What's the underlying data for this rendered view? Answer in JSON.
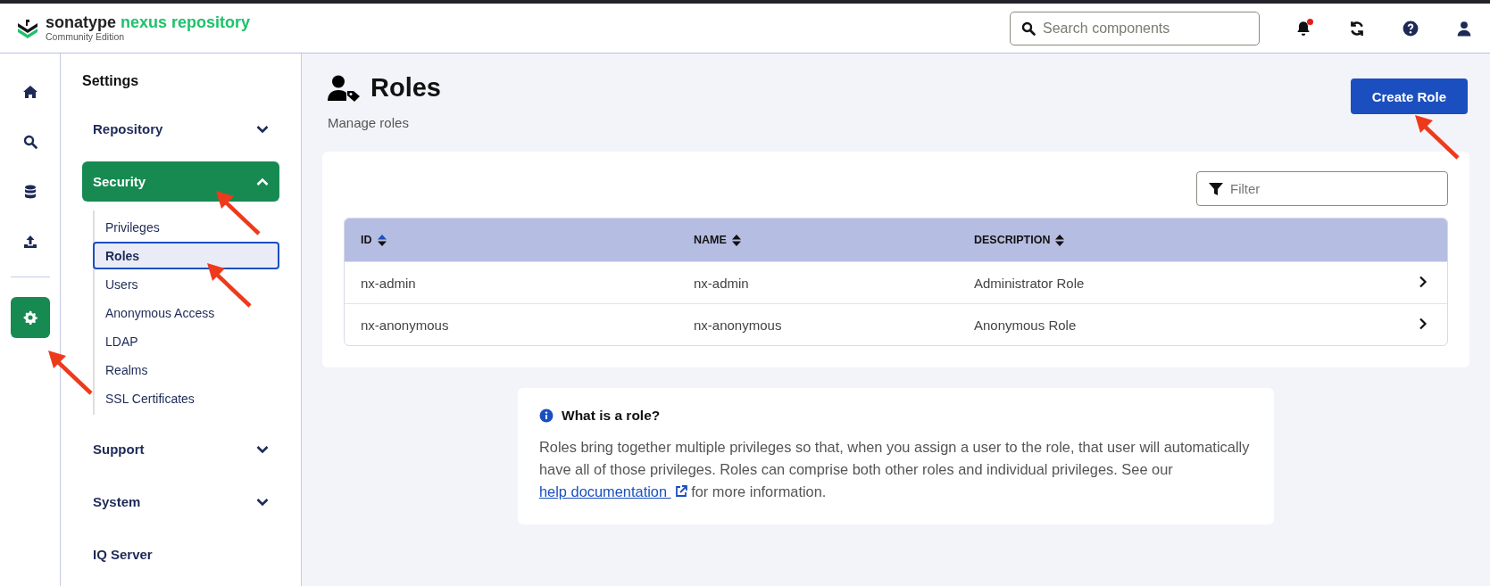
{
  "header": {
    "logo": {
      "brand": "sonatype",
      "product": "nexus repository",
      "edition": "Community Edition"
    },
    "search": {
      "placeholder": "Search components"
    },
    "notifications": {
      "unread": true
    }
  },
  "rail": [
    {
      "kind": "home",
      "selected": false,
      "annotated": false
    },
    {
      "kind": "search",
      "selected": false,
      "annotated": false
    },
    {
      "kind": "database",
      "selected": false,
      "annotated": false
    },
    {
      "kind": "upload",
      "selected": false,
      "annotated": false
    },
    {
      "kind": "settings",
      "selected": true,
      "annotated": true
    }
  ],
  "nav": {
    "title": "Settings",
    "sections": [
      {
        "label": "Repository",
        "expanded": false,
        "selected": false,
        "annotated": false
      },
      {
        "label": "Security",
        "expanded": true,
        "selected": true,
        "annotated": true,
        "children": [
          {
            "label": "Privileges",
            "selected": false,
            "annotated": false
          },
          {
            "label": "Roles",
            "selected": true,
            "annotated": true
          },
          {
            "label": "Users",
            "selected": false,
            "annotated": false
          },
          {
            "label": "Anonymous Access",
            "selected": false,
            "annotated": false
          },
          {
            "label": "LDAP",
            "selected": false,
            "annotated": false
          },
          {
            "label": "Realms",
            "selected": false,
            "annotated": false
          },
          {
            "label": "SSL Certificates",
            "selected": false,
            "annotated": false
          }
        ]
      },
      {
        "label": "Support",
        "expanded": false,
        "selected": false,
        "annotated": false
      },
      {
        "label": "System",
        "expanded": false,
        "selected": false,
        "annotated": false
      },
      {
        "label": "IQ Server",
        "selected": false,
        "annotated": false
      }
    ]
  },
  "page": {
    "title": "Roles",
    "subtitle": "Manage roles",
    "create_button": {
      "label": "Create Role",
      "annotated": true
    },
    "filter": {
      "placeholder": "Filter"
    },
    "table": {
      "columns": [
        {
          "label": "ID",
          "sorted": true
        },
        {
          "label": "NAME",
          "sorted": false
        },
        {
          "label": "DESCRIPTION",
          "sorted": false
        }
      ],
      "rows": [
        [
          "nx-admin",
          "nx-admin",
          "Administrator Role"
        ],
        [
          "nx-anonymous",
          "nx-anonymous",
          "Anonymous Role"
        ]
      ]
    },
    "info": {
      "title": "What is a role?",
      "text_before": "Roles bring together multiple privileges so that, when you assign a user to the role, that user will automatically have all of those privileges. Roles can comprise both other roles and individual privileges. See our",
      "link": "help documentation",
      "text_after": "for more information."
    }
  }
}
